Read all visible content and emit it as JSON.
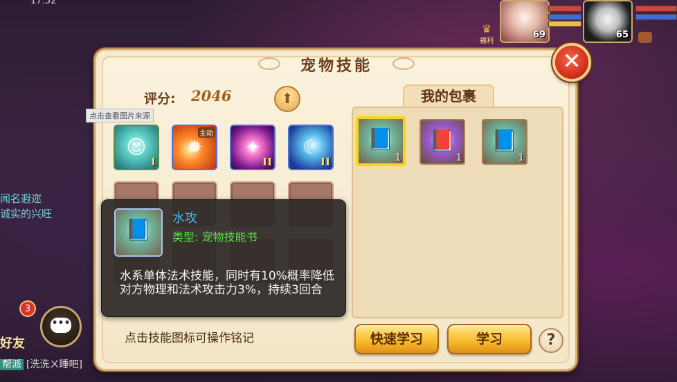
{
  "status_bar": {
    "time": "17:52"
  },
  "hud": {
    "portrait_1_level": "69",
    "portrait_2_level": "65",
    "welfare_label": "福利"
  },
  "background_chat": {
    "line_1": "闻名遐迩",
    "line_2": "诚实的兴旺",
    "friend_badge_count": "3",
    "friend_label": "好友",
    "bottom_tag": "帮派",
    "bottom_message": "[洗洗ㄨ睡吧]"
  },
  "dialog": {
    "title": "宠物技能",
    "score_label": "评分:",
    "score_value": "2046",
    "source_tooltip": "点击查看图片来源",
    "skills": [
      {
        "name": "water-ghost-skill",
        "grade": "I",
        "tag": ""
      },
      {
        "name": "fire-burst-skill",
        "grade": "",
        "tag": "主动"
      },
      {
        "name": "star-slash-skill",
        "grade": "II",
        "tag": ""
      },
      {
        "name": "water-arc-skill",
        "grade": "II",
        "tag": ""
      }
    ],
    "bag": {
      "tab_label": "我的包裹",
      "items": [
        {
          "kind": "teal-skill-book",
          "count": "1",
          "selected": true
        },
        {
          "kind": "purple-skill-book",
          "count": "1",
          "selected": false
        },
        {
          "kind": "teal-skill-book",
          "count": "1",
          "selected": false
        }
      ]
    },
    "detail": {
      "name": "水攻",
      "type": "类型: 宠物技能书",
      "description": "水系单体法术技能，同时有10%概率降低对方物理和法术攻击力3%，持续3回合"
    },
    "hint": "点击技能图标可操作铭记",
    "buttons": {
      "quick_learn": "快速学习",
      "learn": "学习",
      "help": "?"
    },
    "close_glyph": "✕",
    "up_glyph": "⬆"
  }
}
